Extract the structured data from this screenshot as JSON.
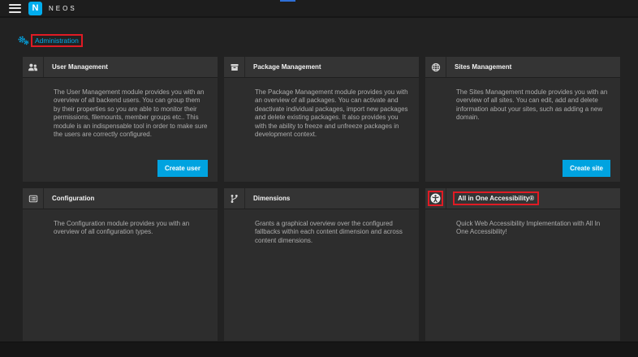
{
  "topbar": {
    "logo_letter": "N",
    "brand": "NEOS"
  },
  "section": {
    "title": "Administration",
    "title_color": "#00adee",
    "icon": "cogs-icon"
  },
  "cards": [
    {
      "icon": "users-icon",
      "title": "User Management",
      "description": "The User Management module provides you with an overview of all backend users. You can group them by their properties so you are able to monitor their permissions, filemounts, member groups etc.. This module is an indispensable tool in order to make sure the users are correctly configured.",
      "button": "Create user"
    },
    {
      "icon": "archive-icon",
      "title": "Package Management",
      "description": "The Package Management module provides you with an overview of all packages. You can activate and deactivate individual packages, import new packages and delete existing packages. It also provides you with the ability to freeze and unfreeze packages in development context."
    },
    {
      "icon": "globe-icon",
      "title": "Sites Management",
      "description": "The Sites Management module provides you with an overview of all sites. You can edit, add and delete information about your sites, such as adding a new domain.",
      "button": "Create site"
    },
    {
      "icon": "list-icon",
      "title": "Configuration",
      "description": "The Configuration module provides you with an overview of all configuration types."
    },
    {
      "icon": "fork-icon",
      "title": "Dimensions",
      "description": "Grants a graphical overview over the configured fallbacks within each content dimension and across content dimensions."
    },
    {
      "icon": "accessibility-icon",
      "title": "All in One Accessibility®",
      "description": "Quick Web Accessibility Implementation with All In One Accessibility!",
      "annotated": true
    }
  ],
  "colors": {
    "accent": "#00adee",
    "button_blue": "#00a3e0",
    "annotation_red": "#e01b24",
    "card_bg": "#2d2d2d",
    "page_bg": "#222222"
  }
}
